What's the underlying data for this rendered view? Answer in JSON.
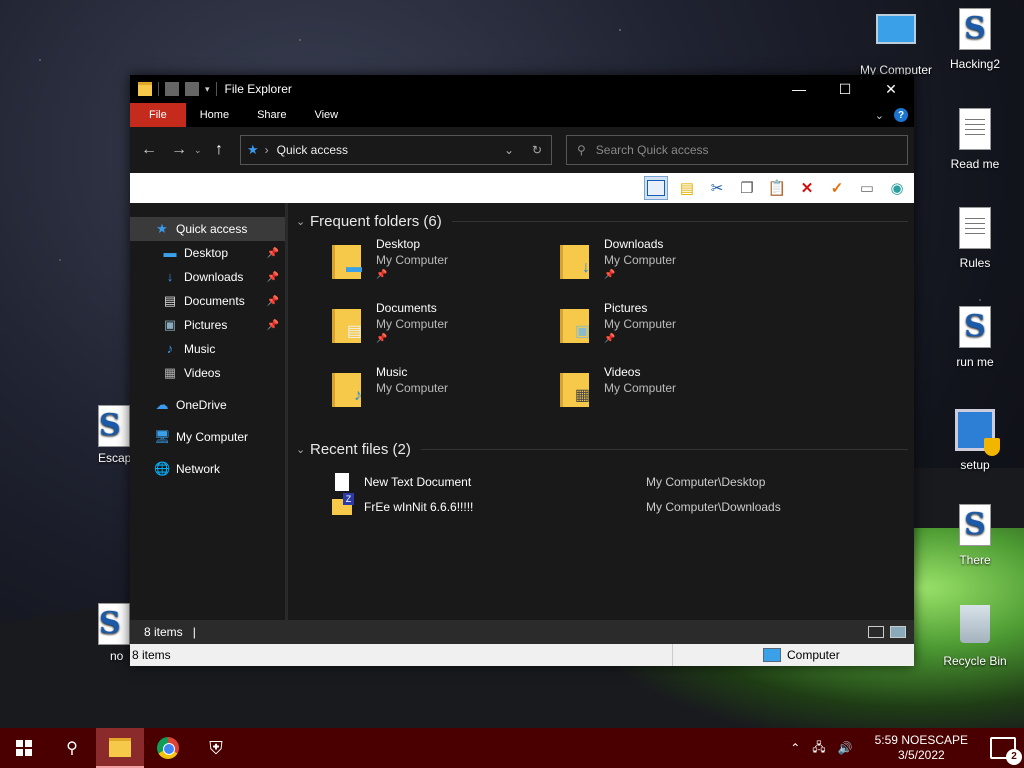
{
  "desktop": {
    "icons": [
      {
        "label": "My Computer"
      },
      {
        "label": "Hacking2"
      },
      {
        "label": "Read me"
      },
      {
        "label": "Rules"
      },
      {
        "label": "run me"
      },
      {
        "label": "setup"
      },
      {
        "label": "There"
      },
      {
        "label": "Recycle Bin"
      },
      {
        "label": "Escap"
      },
      {
        "label": "no"
      }
    ]
  },
  "window": {
    "title": "File Explorer",
    "controls": {
      "minimize": "—",
      "maximize": "☐",
      "close": "✕"
    },
    "ribbon": {
      "file": "File",
      "home": "Home",
      "share": "Share",
      "view": "View",
      "help": "?"
    },
    "address": {
      "location": "Quick access"
    },
    "search": {
      "placeholder": "Search Quick access"
    },
    "nav": {
      "quick_access": "Quick access",
      "items": [
        "Desktop",
        "Downloads",
        "Documents",
        "Pictures",
        "Music",
        "Videos"
      ],
      "onedrive": "OneDrive",
      "computer": "My Computer",
      "network": "Network"
    },
    "frequent": {
      "heading": "Frequent folders (6)",
      "folders": [
        {
          "name": "Desktop",
          "location": "My Computer"
        },
        {
          "name": "Downloads",
          "location": "My Computer"
        },
        {
          "name": "Documents",
          "location": "My Computer"
        },
        {
          "name": "Pictures",
          "location": "My Computer"
        },
        {
          "name": "Music",
          "location": "My Computer"
        },
        {
          "name": "Videos",
          "location": "My Computer"
        }
      ]
    },
    "recent": {
      "heading": "Recent files (2)",
      "files": [
        {
          "name": "New Text Document",
          "path": "My Computer\\Desktop"
        },
        {
          "name": "FrEe wInNit 6.6.6!!!!!",
          "path": "My Computer\\Downloads"
        }
      ]
    },
    "status": {
      "items": "8 items",
      "items2": "8 items",
      "zone": "Computer"
    }
  },
  "taskbar": {
    "time": "5:59 NOESCAPE",
    "date": "3/5/2022",
    "notifications": "2"
  },
  "colors": {
    "accent": "#c42b1c",
    "taskbar": "#4a0000",
    "folder": "#f6c94a"
  }
}
